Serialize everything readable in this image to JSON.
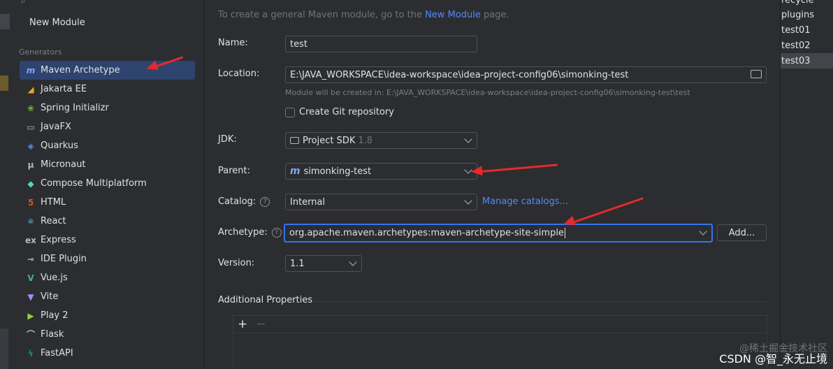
{
  "sidebar": {
    "title": "New Module",
    "section_label": "Generators",
    "items": [
      {
        "label": "Maven Archetype",
        "icon": "maven-icon",
        "selected": true
      },
      {
        "label": "Jakarta EE",
        "icon": "jakarta-icon"
      },
      {
        "label": "Spring Initializr",
        "icon": "spring-icon"
      },
      {
        "label": "JavaFX",
        "icon": "javafx-icon"
      },
      {
        "label": "Quarkus",
        "icon": "quarkus-icon"
      },
      {
        "label": "Micronaut",
        "icon": "micronaut-icon"
      },
      {
        "label": "Compose Multiplatform",
        "icon": "compose-icon"
      },
      {
        "label": "HTML",
        "icon": "html5-icon"
      },
      {
        "label": "React",
        "icon": "react-icon"
      },
      {
        "label": "Express",
        "icon": "express-icon"
      },
      {
        "label": "IDE Plugin",
        "icon": "plugin-icon"
      },
      {
        "label": "Vue.js",
        "icon": "vue-icon"
      },
      {
        "label": "Vite",
        "icon": "vite-icon"
      },
      {
        "label": "Play 2",
        "icon": "play-icon"
      },
      {
        "label": "Flask",
        "icon": "flask-icon"
      },
      {
        "label": "FastAPI",
        "icon": "fastapi-icon"
      }
    ]
  },
  "form": {
    "hint_prefix": "To create a general Maven module, go to the ",
    "hint_link": "New Module",
    "hint_suffix": " page.",
    "name_label": "Name:",
    "name_value": "test",
    "location_label": "Location:",
    "location_value": "E:\\JAVA_WORKSPACE\\idea-workspace\\idea-project-config06\\simonking-test",
    "location_hint": "Module will be created in: E:\\JAVA_WORKSPACE\\idea-workspace\\idea-project-config06\\simonking-test\\test",
    "git_label": "Create Git repository",
    "git_checked": false,
    "jdk_label": "JDK:",
    "jdk_value": "Project SDK",
    "jdk_version": "1.8",
    "parent_label": "Parent:",
    "parent_value": "simonking-test",
    "catalog_label": "Catalog:",
    "catalog_value": "Internal",
    "manage_catalogs": "Manage catalogs...",
    "archetype_label": "Archetype:",
    "archetype_value": "org.apache.maven.archetypes:maven-archetype-site-simple",
    "add_button": "Add...",
    "version_label": "Version:",
    "version_value": "1.1",
    "additional_properties": "Additional Properties",
    "add_tool": "+",
    "remove_tool": "−"
  },
  "right_panel": {
    "items": [
      "recycle",
      "plugins",
      "test01",
      "test02",
      "test03"
    ],
    "selected_index": 4
  },
  "watermark": {
    "line1": "@稀土掘金技术社区",
    "line2": "CSDN @智_永无止境"
  },
  "colors": {
    "accent": "#3574f0",
    "link": "#548af7",
    "selection": "#2e436e",
    "annotation_arrow": "#e8292b"
  }
}
